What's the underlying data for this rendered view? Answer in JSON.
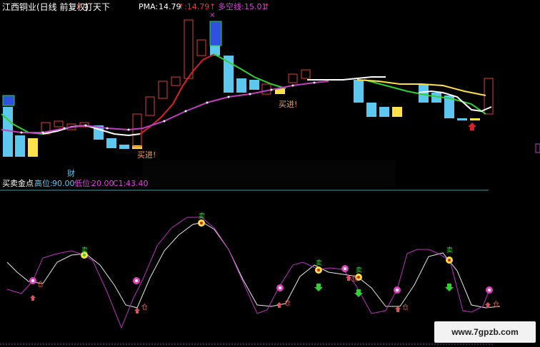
{
  "header": {
    "title": "江西铜业(日线 前复权)",
    "arrow": "↑",
    "indicator_name": "打天下",
    "pma_label": "PMA:",
    "pma_value": "14.79",
    "pma_arrow": "↑",
    "pma_value2": ":14.79",
    "pma_arrow2": "↑",
    "ma_label": "多空线:",
    "ma_value": "15.01",
    "ma_arrow": "↑"
  },
  "annotations": {
    "buy1": "买进!",
    "buy2": "买进!",
    "cai": "财"
  },
  "sub_header": {
    "name": "买卖金点",
    "high_label": "高位:",
    "high_value": "90.00",
    "low_label": "低位:",
    "low_value": "20.00",
    "c1_label": "C1:",
    "c1_value": "43.40"
  },
  "signals": {
    "sell": "卖",
    "cang": "仓"
  },
  "watermark": "www.7gpzb.com",
  "colors": {
    "background": "#000000",
    "up_candle": "#e03c3c",
    "down_candle": "#5cc8f0",
    "yellow": "#ffe14a",
    "pma_line_up": "#e02020",
    "pma_line_down": "#30d030",
    "ma_line": "#c040c0",
    "white": "#ffffff",
    "separator": "#3a9fa8",
    "white_kdj": "#e8e8e8",
    "magenta_kdj": "#c030c0"
  }
}
